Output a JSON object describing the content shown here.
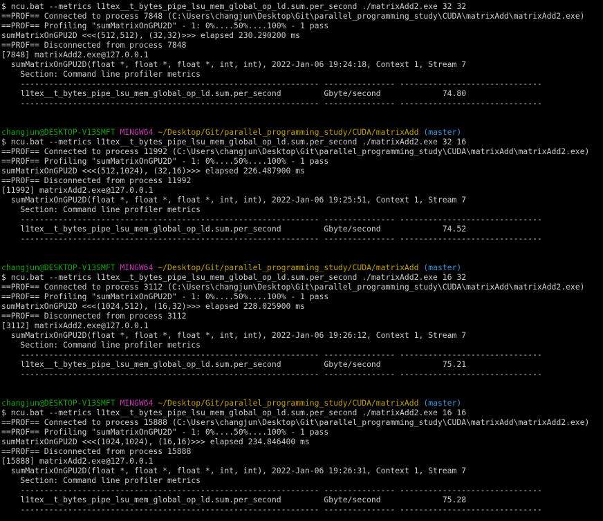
{
  "prompt": {
    "user_host": "changjun@DESKTOP-V13SMFT",
    "shell": "MINGW64",
    "cwd": "~/Desktop/Git/parallel_programming_study/CUDA/matrixAdd",
    "branch": "(master)"
  },
  "table": {
    "divider_left": "--------------------------------------------------------------- ---------------",
    "divider_right": "------------------------------",
    "metric_name": "l1tex__t_bytes_pipe_lsu_mem_global_op_ld.sum.per_second",
    "metric_unit": "Gbyte/second"
  },
  "runs": [
    {
      "command": "$ ncu.bat --metrics l1tex__t_bytes_pipe_lsu_mem_global_op_ld.sum.per_second ./matrixAdd2.exe 32 32",
      "connected": "==PROF== Connected to process 7848 (C:\\Users\\changjun\\Desktop\\Git\\parallel_programming_study\\CUDA\\matrixAdd\\matrixAdd2.exe)",
      "profiling": "==PROF== Profiling \"sumMatrixOnGPU2D\" - 1: 0%....50%....100% - 1 pass",
      "elapsed": "sumMatrixOnGPU2D <<<(512,512), (32,32)>>> elapsed 230.290200 ms",
      "disconnected": "==PROF== Disconnected from process 7848",
      "pid_line": "[7848] matrixAdd2.exe@127.0.0.1",
      "kernel_line": "  sumMatrixOnGPU2D(float *, float *, float *, int, int), 2022-Jan-06 19:24:18, Context 1, Stream 7",
      "section_line": "    Section: Command line profiler metrics",
      "metric_value": "74.80"
    },
    {
      "command": "$ ncu.bat --metrics l1tex__t_bytes_pipe_lsu_mem_global_op_ld.sum.per_second ./matrixAdd2.exe 32 16",
      "connected": "==PROF== Connected to process 11992 (C:\\Users\\changjun\\Desktop\\Git\\parallel_programming_study\\CUDA\\matrixAdd\\matrixAdd2.exe)",
      "profiling": "==PROF== Profiling \"sumMatrixOnGPU2D\" - 1: 0%....50%....100% - 1 pass",
      "elapsed": "sumMatrixOnGPU2D <<<(512,1024), (32,16)>>> elapsed 226.487900 ms",
      "disconnected": "==PROF== Disconnected from process 11992",
      "pid_line": "[11992] matrixAdd2.exe@127.0.0.1",
      "kernel_line": "  sumMatrixOnGPU2D(float *, float *, float *, int, int), 2022-Jan-06 19:25:51, Context 1, Stream 7",
      "section_line": "    Section: Command line profiler metrics",
      "metric_value": "74.52"
    },
    {
      "command": "$ ncu.bat --metrics l1tex__t_bytes_pipe_lsu_mem_global_op_ld.sum.per_second ./matrixAdd2.exe 16 32",
      "connected": "==PROF== Connected to process 3112 (C:\\Users\\changjun\\Desktop\\Git\\parallel_programming_study\\CUDA\\matrixAdd\\matrixAdd2.exe)",
      "profiling": "==PROF== Profiling \"sumMatrixOnGPU2D\" - 1: 0%....50%....100% - 1 pass",
      "elapsed": "sumMatrixOnGPU2D <<<(1024,512), (16,32)>>> elapsed 228.025900 ms",
      "disconnected": "==PROF== Disconnected from process 3112",
      "pid_line": "[3112] matrixAdd2.exe@127.0.0.1",
      "kernel_line": "  sumMatrixOnGPU2D(float *, float *, float *, int, int), 2022-Jan-06 19:26:12, Context 1, Stream 7",
      "section_line": "    Section: Command line profiler metrics",
      "metric_value": "75.21"
    },
    {
      "command": "$ ncu.bat --metrics l1tex__t_bytes_pipe_lsu_mem_global_op_ld.sum.per_second ./matrixAdd2.exe 16 16",
      "connected": "==PROF== Connected to process 15888 (C:\\Users\\changjun\\Desktop\\Git\\parallel_programming_study\\CUDA\\matrixAdd\\matrixAdd2.exe)",
      "profiling": "==PROF== Profiling \"sumMatrixOnGPU2D\" - 1: 0%....50%....100% - 1 pass",
      "elapsed": "sumMatrixOnGPU2D <<<(1024,1024), (16,16)>>> elapsed 234.846400 ms",
      "disconnected": "==PROF== Disconnected from process 15888",
      "pid_line": "[15888] matrixAdd2.exe@127.0.0.1",
      "kernel_line": "  sumMatrixOnGPU2D(float *, float *, float *, int, int), 2022-Jan-06 19:26:31, Context 1, Stream 7",
      "section_line": "    Section: Command line profiler metrics",
      "metric_value": "75.28"
    }
  ],
  "colors": {
    "background": "#000000",
    "text": "#cccccc",
    "prompt_user": "#13a10e",
    "prompt_shell": "#c239b3",
    "prompt_path": "#c19c00",
    "prompt_branch": "#3a96dd"
  }
}
